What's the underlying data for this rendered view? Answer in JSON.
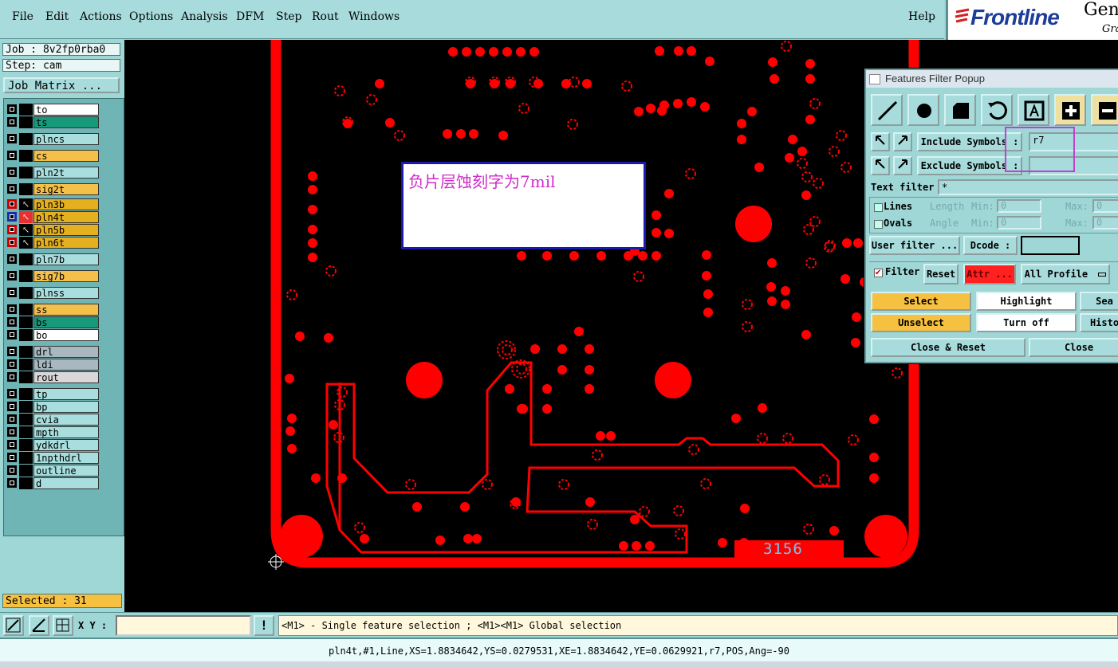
{
  "menu": {
    "items": [
      "File",
      "Edit",
      "Actions",
      "Options",
      "Analysis",
      "DFM",
      "Step",
      "Rout",
      "Windows"
    ],
    "help": "Help"
  },
  "brand": {
    "logo": "Frontline",
    "gen": "Gen",
    "gra": "Gra"
  },
  "job": {
    "job_label": "Job : 8v2fp0rba0",
    "step_label": "Step: cam",
    "matrix_button": "Job Matrix ..."
  },
  "layers": [
    {
      "name": "to",
      "color": "white"
    },
    {
      "name": "ts",
      "color": "green"
    },
    {
      "name": "plncs",
      "color": "cyan"
    },
    {
      "name": "cs",
      "color": "orange"
    },
    {
      "name": "pln2t",
      "color": "cyan"
    },
    {
      "name": "sig2t",
      "color": "orange"
    },
    {
      "name": "pln3b",
      "color": "gold"
    },
    {
      "name": "pln4t",
      "color": "gold"
    },
    {
      "name": "pln5b",
      "color": "gold"
    },
    {
      "name": "pln6t",
      "color": "gold"
    },
    {
      "name": "pln7b",
      "color": "cyan"
    },
    {
      "name": "sig7b",
      "color": "orange"
    },
    {
      "name": "plnss",
      "color": "cyan"
    },
    {
      "name": "ss",
      "color": "orange"
    },
    {
      "name": "bs",
      "color": "green"
    },
    {
      "name": "bo",
      "color": "white"
    },
    {
      "name": "drl",
      "color": "grey"
    },
    {
      "name": "ldi",
      "color": "grey"
    },
    {
      "name": "rout",
      "color": "ltgrey"
    },
    {
      "name": "tp",
      "color": "cyan"
    },
    {
      "name": "bp",
      "color": "cyan"
    },
    {
      "name": "cvia",
      "color": "cyan"
    },
    {
      "name": "mpth",
      "color": "cyan"
    },
    {
      "name": "ydkdrl",
      "color": "cyan"
    },
    {
      "name": "1npthdrl",
      "color": "cyan"
    },
    {
      "name": "outline",
      "color": "cyan"
    },
    {
      "name": "d",
      "color": "cyan"
    }
  ],
  "selected": "Selected : 31",
  "annotation": "负片层蚀刻字为7mil",
  "board_number": "3156",
  "popup": {
    "title": "Features Filter Popup",
    "include_label": "Include Symbols :",
    "include_value": "r7",
    "exclude_label": "Exclude Symbols :",
    "exclude_value": "",
    "text_filter_label": "Text filter",
    "text_filter_value": "*",
    "lines_label": "Lines",
    "ovals_label": "Ovals",
    "length_label": "Length",
    "angle_label": "Angle",
    "min_label": "Min:",
    "max_label": "Max:",
    "min_value": "0",
    "max_value": "0",
    "user_filter": "User filter ...",
    "dcode_label": "Dcode :",
    "filter_label": "Filter",
    "reset_label": "Reset",
    "attr_label": "Attr ...",
    "profile_label": "All Profile",
    "select": "Select",
    "highlight": "Highlight",
    "search": "Sea",
    "unselect": "Unselect",
    "turn_off": "Turn off",
    "history": "Histo",
    "close_reset": "Close & Reset",
    "close": "Close"
  },
  "bottom": {
    "xy_label": "X Y :",
    "xy_value": "",
    "bang": "!",
    "hint": "<M1> - Single feature selection ; <M1><M1> Global selection"
  },
  "status": "pln4t,#1,Line,XS=1.8834642,YS=0.0279531,XE=1.8834642,YE=0.0629921,r7,POS,Ang=-90",
  "colors": {
    "canvas": "#000000",
    "feature": "#ff0000",
    "panel": "#9fd6d6",
    "annotation_text": "#d02cc8"
  }
}
